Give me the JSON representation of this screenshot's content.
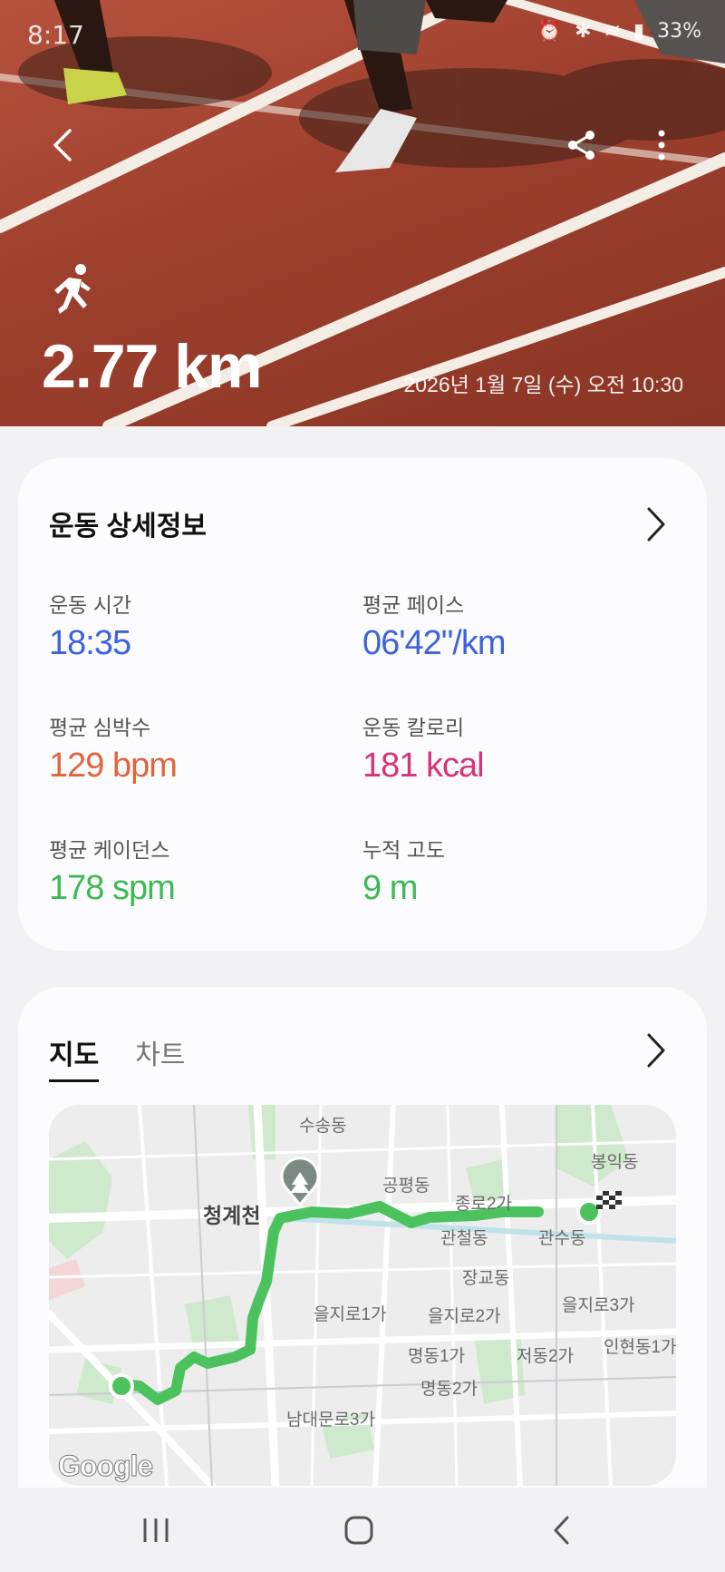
{
  "status_bar": {
    "time": "8:17",
    "battery": "33%"
  },
  "hero": {
    "distance": "2.77 km",
    "datetime": "2026년 1월 7일 (수) 오전 10:30",
    "icons": [
      "back-icon",
      "share-icon",
      "more-vert-icon",
      "running-icon"
    ]
  },
  "details": {
    "title": "운동 상세정보",
    "metrics": [
      {
        "label": "운동 시간",
        "value": "18:35",
        "color": "#3d63dd"
      },
      {
        "label": "평균 페이스",
        "value": "06'42\"/km",
        "color": "#3d63dd"
      },
      {
        "label": "평균 심박수",
        "value": "129 bpm",
        "color": "#e0653c"
      },
      {
        "label": "운동 칼로리",
        "value": "181 kcal",
        "color": "#d6337a"
      },
      {
        "label": "평균 케이던스",
        "value": "178 spm",
        "color": "#3cba54"
      },
      {
        "label": "누적 고도",
        "value": "9 m",
        "color": "#3cba54"
      }
    ]
  },
  "map_card": {
    "tabs": [
      {
        "label": "지도",
        "active": true
      },
      {
        "label": "차트",
        "active": false
      }
    ],
    "map_labels": [
      "수송동",
      "청계천",
      "공평동",
      "종로2가",
      "봉익동",
      "관철동",
      "관수동",
      "장교동",
      "을지로3가",
      "을지로1가",
      "을지로2가",
      "명동1가",
      "저동2가",
      "인현동1가",
      "명동2가",
      "남대문로3가"
    ],
    "route_color": "#4cc25f",
    "attribution": "Google"
  },
  "nav_bar": {
    "icons": [
      "recent-apps-icon",
      "home-icon",
      "back-nav-icon"
    ]
  }
}
